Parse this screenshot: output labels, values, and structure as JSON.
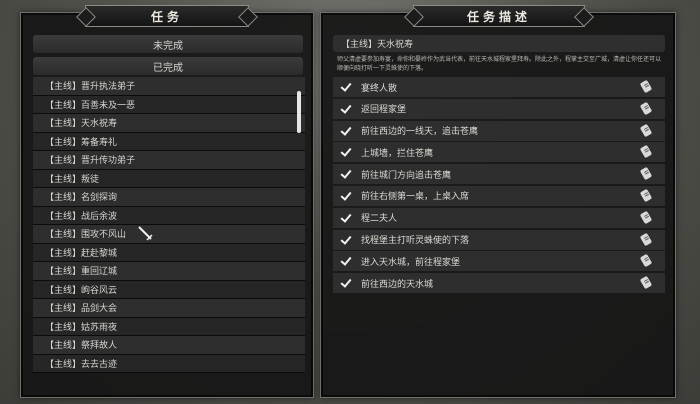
{
  "left": {
    "title": "任务",
    "filters": {
      "incomplete": "未完成",
      "completed": "已完成"
    },
    "quests": [
      "【主线】晋升执法弟子",
      "【主线】百善未及一恶",
      "【主线】天水祝寿",
      "【主线】筹备寿礼",
      "【主线】晋升传功弟子",
      "【主线】叛徒",
      "【主线】名剑探询",
      "【主线】战后余波",
      "【主线】围攻不风山",
      "【主线】赶赴黎城",
      "【主线】重回辽城",
      "【主线】岣谷风云",
      "【主线】品剑大会",
      "【主线】姑苏雨夜",
      "【主线】祭拜故人",
      "【主线】去去古迹"
    ]
  },
  "right": {
    "title": "任务描述",
    "selected_quest": "【主线】天水祝寿",
    "description": "师父清虚要参加寿宴，命你和晏岭作为武当代表，前往天水城程家堡拜寿。除此之外，程掌主交至广城，清虚让你任还可以顺便向晓打听一下灵蛛使的下落。",
    "tasks": [
      "宴终人散",
      "返回程家堡",
      "前往西边的一线天，追击苍鹰",
      "上城墙，拦住苍鹰",
      "前往城门方向追击苍鹰",
      "前往右侧第一桌，上桌入席",
      "程二夫人",
      "找程堡主打听灵蛛使的下落",
      "进入天水城，前往程家堡",
      "前往西边的天水城"
    ]
  }
}
